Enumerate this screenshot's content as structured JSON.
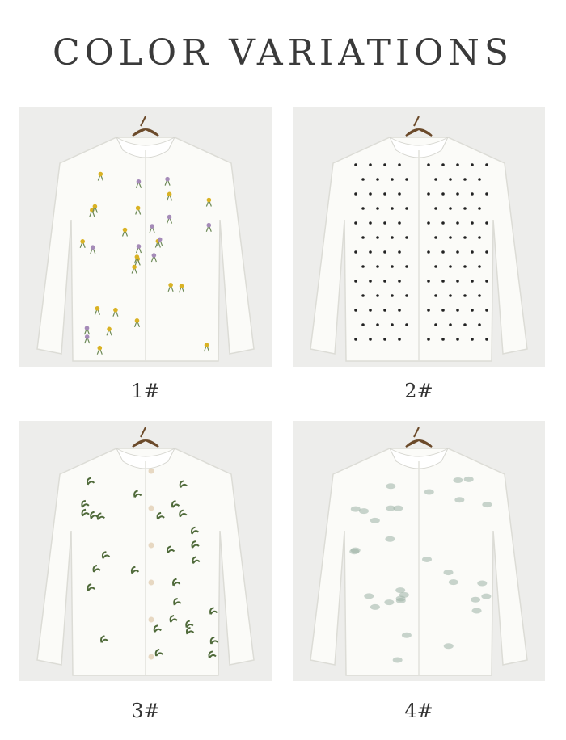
{
  "title": "COLOR VARIATIONS",
  "variants": [
    {
      "label": "1#",
      "pattern": "embroidered-flowers",
      "accent": "#d9b224"
    },
    {
      "label": "2#",
      "pattern": "polka-dots",
      "accent": "#222222"
    },
    {
      "label": "3#",
      "pattern": "embroidered-leaves",
      "accent": "#4f6a3a"
    },
    {
      "label": "4#",
      "pattern": "floral-print",
      "accent": "#9cb2a6"
    }
  ]
}
